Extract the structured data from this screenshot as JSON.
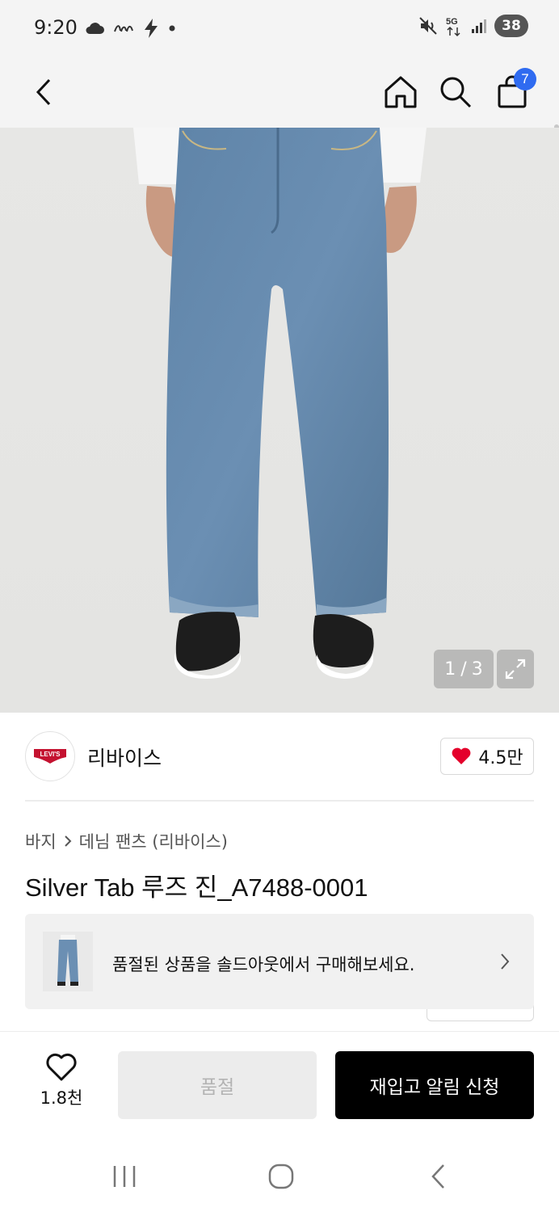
{
  "status_bar": {
    "time": "9:20",
    "left_icons": [
      "cloud-icon",
      "app-logo-icon",
      "bolt-icon",
      "dot-icon"
    ],
    "network": "5G",
    "battery": "38",
    "right_icons": [
      "mute-icon",
      "5g-icon",
      "signal-icon",
      "battery-icon"
    ]
  },
  "top_nav": {
    "back_icon": "chevron-left-icon",
    "home_icon": "home-icon",
    "search_icon": "search-icon",
    "cart_icon": "shopping-bag-icon",
    "cart_count": "7"
  },
  "gallery": {
    "current": "1",
    "separator": "/",
    "total": "3",
    "expand_icon": "expand-icon"
  },
  "brand": {
    "logo_text": "LEVI'S",
    "name": "리바이스",
    "like_count": "4.5만"
  },
  "breadcrumb": {
    "category": "바지",
    "subcategory": "데님 팬츠 (리바이스)"
  },
  "product": {
    "title": "Silver Tab 루즈 진_A7488-0001"
  },
  "soldout_banner": {
    "text": "품절된 상품을 솔드아웃에서 구매해보세요."
  },
  "bottom_bar": {
    "wish_count": "1.8천",
    "soldout_label": "품절",
    "restock_label": "재입고 알림 신청"
  },
  "colors": {
    "accent": "#2f6bf0",
    "heart": "#e4002b",
    "primary_button": "#000000",
    "disabled_button": "#ececec",
    "levis_red": "#c41230"
  }
}
